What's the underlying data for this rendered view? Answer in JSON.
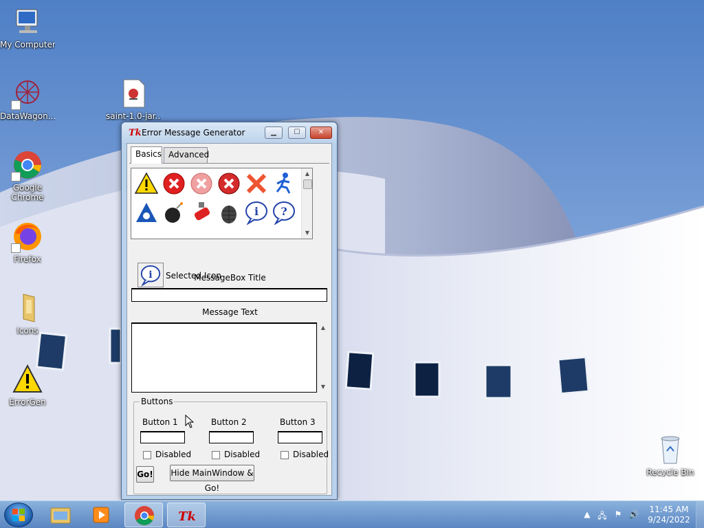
{
  "desktop": {
    "icons": [
      {
        "label": "My Computer",
        "icon": "computer-icon"
      },
      {
        "label": "DataWagon...",
        "icon": "datawagon-icon"
      },
      {
        "label": "saint-1.0-jar...",
        "icon": "jar-file-icon"
      },
      {
        "label": "Google Chrome",
        "icon": "chrome-icon"
      },
      {
        "label": "Firefox",
        "icon": "firefox-icon"
      },
      {
        "label": "Icons",
        "icon": "folder-icon"
      },
      {
        "label": "ErrorGen",
        "icon": "warning-icon"
      },
      {
        "label": "Recycle Bin",
        "icon": "recycle-bin-icon"
      }
    ]
  },
  "window": {
    "title": "Error Message Generator",
    "tabs": [
      {
        "label": "Basics",
        "selected": true
      },
      {
        "label": "Advanced",
        "selected": false
      }
    ],
    "icon_grid": {
      "icons": [
        "warning-icon",
        "error-red-icon",
        "error-faded-icon",
        "error-x-icon",
        "red-x-icon",
        "running-man-icon",
        "aol-triangle-icon",
        "bomb-icon",
        "fire-extinguisher-icon",
        "grenade-icon",
        "info-icon",
        "question-icon"
      ]
    },
    "selected_icon_label": "Selected Icon",
    "messagebox_title_label": "MessageBox Title",
    "messagebox_title_value": "",
    "message_text_label": "Message Text",
    "message_text_value": "",
    "buttons_group": {
      "legend": "Buttons",
      "buttons": [
        {
          "label": "Button 1",
          "value": "",
          "disabled_label": "Disabled",
          "disabled": false
        },
        {
          "label": "Button 2",
          "value": "",
          "disabled_label": "Disabled",
          "disabled": false
        },
        {
          "label": "Button 3",
          "value": "",
          "disabled_label": "Disabled",
          "disabled": false
        }
      ],
      "go_label": "Go!",
      "hide_go_label": "Hide MainWindow & Go!"
    }
  },
  "taskbar": {
    "pinned": [
      "windows-explorer-icon",
      "media-player-icon",
      "chrome-icon",
      "tk-icon"
    ],
    "clock_time": "11:45 AM",
    "clock_date": "9/24/2022",
    "tray": [
      "chevron-up-icon",
      "network-icon",
      "action-center-icon",
      "volume-icon"
    ]
  },
  "colors": {
    "sky": "#6b93cf",
    "building": "#e9ecf5",
    "taskbar": "#5b86c1"
  }
}
